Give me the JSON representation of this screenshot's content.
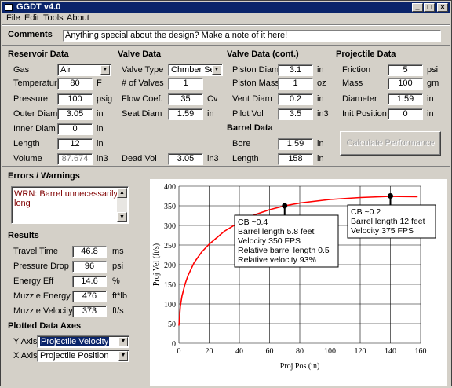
{
  "window": {
    "title": "GGDT v4.0",
    "min": "_",
    "max": "□",
    "close": "×"
  },
  "menu": [
    "File",
    "Edit",
    "Tools",
    "About"
  ],
  "comments": {
    "label": "Comments",
    "value": "Anything special about the design?  Make a note of it here!"
  },
  "reservoir": {
    "header": "Reservoir Data",
    "gas_label": "Gas",
    "gas_value": "Air",
    "rows": [
      {
        "label": "Temperature",
        "value": "80",
        "unit": "F"
      },
      {
        "label": "Pressure",
        "value": "100",
        "unit": "psig"
      },
      {
        "label": "Outer Diam",
        "value": "3.05",
        "unit": "in"
      },
      {
        "label": "Inner Diam",
        "value": "0",
        "unit": "in"
      },
      {
        "label": "Length",
        "value": "12",
        "unit": "in"
      },
      {
        "label": "Volume",
        "value": "87.674",
        "unit": "in3"
      }
    ]
  },
  "valve": {
    "header": "Valve Data",
    "type_label": "Valve Type",
    "type_value": "Chmber Seal",
    "rows": [
      {
        "label": "# of Valves",
        "value": "1",
        "unit": ""
      },
      {
        "label": "Flow Coef.",
        "value": "35",
        "unit": "Cv"
      },
      {
        "label": "Seat Diam",
        "value": "1.59",
        "unit": "in"
      }
    ],
    "dead_label": "Dead Vol",
    "dead_value": "3.05",
    "dead_unit": "in3"
  },
  "valve_cont": {
    "header": "Valve Data (cont.)",
    "rows": [
      {
        "label": "Piston Diam",
        "value": "3.1",
        "unit": "in"
      },
      {
        "label": "Piston Mass",
        "value": "1",
        "unit": "oz"
      },
      {
        "label": "Vent Diam",
        "value": "0.2",
        "unit": "in"
      },
      {
        "label": "Pilot Vol",
        "value": "3.5",
        "unit": "in3"
      }
    ]
  },
  "barrel": {
    "header": "Barrel Data",
    "rows": [
      {
        "label": "Bore",
        "value": "1.59",
        "unit": "in"
      },
      {
        "label": "Length",
        "value": "158",
        "unit": "in"
      }
    ]
  },
  "projectile": {
    "header": "Projectile Data",
    "rows": [
      {
        "label": "Friction",
        "value": "5",
        "unit": "psi"
      },
      {
        "label": "Mass",
        "value": "100",
        "unit": "gm"
      },
      {
        "label": "Diameter",
        "value": "1.59",
        "unit": "in"
      },
      {
        "label": "Init Position",
        "value": "0",
        "unit": "in"
      }
    ],
    "calc_button": "Calculate Performance"
  },
  "errors": {
    "header": "Errors / Warnings",
    "items": [
      "WRN: Barrel unnecessarily long"
    ]
  },
  "results": {
    "header": "Results",
    "rows": [
      {
        "label": "Travel Time",
        "value": "46.8",
        "unit": "ms"
      },
      {
        "label": "Pressure Drop",
        "value": "96",
        "unit": "psi"
      },
      {
        "label": "Energy Eff",
        "value": "14.6",
        "unit": "%"
      },
      {
        "label": "Muzzle Energy",
        "value": "476",
        "unit": "ft*lb"
      },
      {
        "label": "Muzzle Velocity",
        "value": "373",
        "unit": "ft/s"
      }
    ]
  },
  "plot_axes": {
    "header": "Plotted Data Axes",
    "y_label": "Y Axis",
    "y_value": "Projectile Velocity",
    "x_label": "X Axis",
    "x_value": "Projectile Position"
  },
  "chart_data": {
    "type": "line",
    "xlabel": "Proj Pos (in)",
    "ylabel": "Proj Vel (ft/s)",
    "xlim": [
      0,
      160
    ],
    "ylim": [
      0,
      400
    ],
    "xticks": [
      0,
      20,
      40,
      60,
      80,
      100,
      120,
      140,
      160
    ],
    "yticks": [
      0,
      50,
      100,
      150,
      200,
      250,
      300,
      350,
      400
    ],
    "grid": true,
    "line_color": "#ff0000",
    "series": [
      {
        "x": [
          0,
          1,
          2,
          4,
          6,
          10,
          15,
          20,
          30,
          40,
          50,
          60,
          70,
          80,
          100,
          120,
          140,
          158
        ],
        "y": [
          45,
          95,
          120,
          150,
          172,
          205,
          232,
          252,
          285,
          308,
          327,
          340,
          350,
          357,
          366,
          371,
          374,
          373
        ]
      }
    ],
    "annotations": [
      {
        "x": 70,
        "y": 350,
        "lines": [
          "CB ~0.4",
          "Barrel length 5.8 feet",
          "Velocity 350 FPS",
          "Relative barrel length 0.5",
          "Relative velocity 93%"
        ]
      },
      {
        "x": 140,
        "y": 375,
        "lines": [
          "CB ~0.2",
          "Barrel length 12 feet",
          "Velocity 375 FPS"
        ]
      }
    ]
  }
}
